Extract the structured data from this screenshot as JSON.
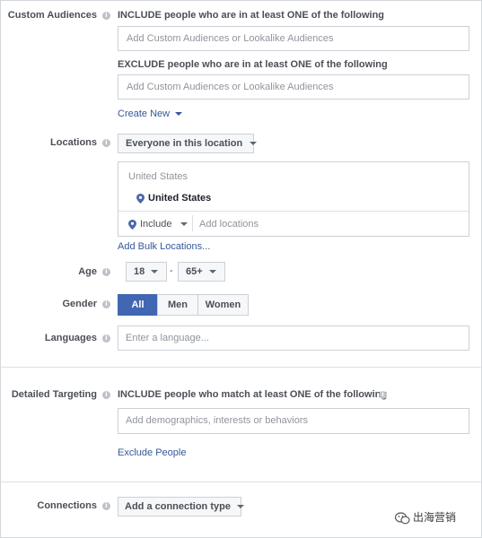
{
  "custom_audiences": {
    "label": "Custom Audiences",
    "include_heading": "INCLUDE people who are in at least ONE of the following",
    "include_placeholder": "Add Custom Audiences or Lookalike Audiences",
    "exclude_heading": "EXCLUDE people who are in at least ONE of the following",
    "exclude_placeholder": "Add Custom Audiences or Lookalike Audiences",
    "create_new": "Create New"
  },
  "locations": {
    "label": "Locations",
    "dropdown": "Everyone in this location",
    "group_header": "United States",
    "selected": "United States",
    "include_dropdown": "Include",
    "add_placeholder": "Add locations",
    "bulk_link": "Add Bulk Locations..."
  },
  "age": {
    "label": "Age",
    "min": "18",
    "separator": "-",
    "max": "65+"
  },
  "gender": {
    "label": "Gender",
    "options": [
      "All",
      "Men",
      "Women"
    ],
    "selected": "All",
    "selected_color": "#4267b2"
  },
  "languages": {
    "label": "Languages",
    "placeholder": "Enter a language..."
  },
  "detailed_targeting": {
    "label": "Detailed Targeting",
    "include_heading": "INCLUDE people who match at least ONE of the following",
    "placeholder": "Add demographics, interests or behaviors",
    "exclude_link": "Exclude People"
  },
  "connections": {
    "label": "Connections",
    "dropdown": "Add a connection type"
  },
  "watermark": {
    "text": "出海营销"
  },
  "colors": {
    "link": "#365899",
    "border": "#ccd0d5",
    "label": "#4b4f56",
    "pin": "#4b6aa6"
  }
}
